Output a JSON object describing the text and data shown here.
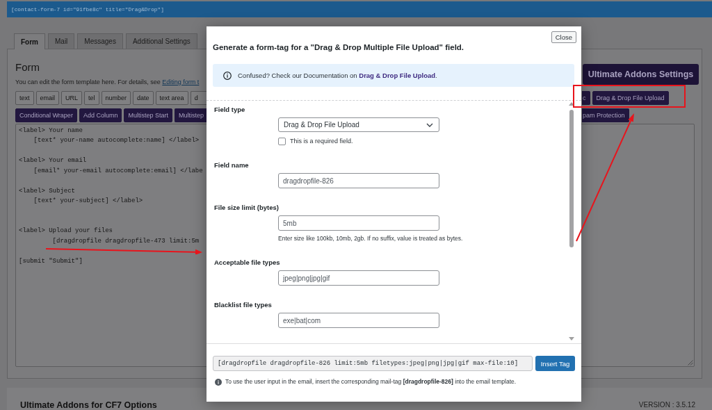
{
  "shortcode": "[contact-form-7 id=\"91fbe8c\" title=\"Drag&Drop\"]",
  "tabs": [
    {
      "label": "Form",
      "selected": true
    },
    {
      "label": "Mail",
      "selected": false
    },
    {
      "label": "Messages",
      "selected": false
    },
    {
      "label": "Additional Settings",
      "selected": false
    }
  ],
  "form_panel": {
    "heading": "Form",
    "description": "You can edit the form template here. For details, see ",
    "description_link": "Editing form t",
    "settings_button": "Ultimate Addons Settings",
    "tag_button_rows": [
      {
        "left": [
          {
            "label": "text",
            "kind": "default"
          },
          {
            "label": "email",
            "kind": "default"
          },
          {
            "label": "URL",
            "kind": "default"
          },
          {
            "label": "tel",
            "kind": "default"
          },
          {
            "label": "number",
            "kind": "default"
          },
          {
            "label": "date",
            "kind": "default"
          },
          {
            "label": "text area",
            "kind": "default"
          },
          {
            "label": "d",
            "kind": "default"
          }
        ],
        "right": [
          {
            "label": "c",
            "kind": "addon"
          },
          {
            "label": "Drag & Drop File Upload",
            "kind": "addon"
          }
        ]
      },
      {
        "left": [
          {
            "label": "Conditional Wraper",
            "kind": "addon"
          },
          {
            "label": "Add Column",
            "kind": "addon"
          },
          {
            "label": "Multistep Start",
            "kind": "addon"
          },
          {
            "label": "Multistep",
            "kind": "addon"
          }
        ],
        "right": [
          {
            "label": "pam Protection",
            "kind": "addon"
          }
        ]
      }
    ],
    "template": "<label> Your name\n    [text* your-name autocomplete:name] </label>\n\n<label> Your email\n    [email* your-email autocomplete:email] </labe\n\n<label> Subject\n    [text* your-subject] </label>\n\n\n<label> Upload your files\n         [dragdropfile dragdropfile-473 limit:5m\n\n[submit \"Submit\"]"
  },
  "options_section": {
    "title": "Ultimate Addons for CF7 Options",
    "version": "VERSION : 3.5.12"
  },
  "modal": {
    "close": "Close",
    "title": "Generate a form-tag for a \"Drag & Drop Multiple File Upload\" field.",
    "notice": {
      "text": "Confused? Check our Documentation on ",
      "link": "Drag & Drop File Upload",
      "after": "."
    },
    "fields": [
      {
        "kind": "select",
        "label": "Field type",
        "value": "Drag & Drop File Upload",
        "checkbox": {
          "label": "This is a required field.",
          "checked": false
        }
      },
      {
        "kind": "text",
        "label": "Field name",
        "value": "dragdropfile-826"
      },
      {
        "kind": "text",
        "label": "File size limit (bytes)",
        "value": "5mb",
        "hint": "Enter size like 100kb, 10mb, 2gb. If no suffix, value is treated as bytes."
      },
      {
        "kind": "text",
        "label": "Acceptable file types",
        "value": "jpeg|png|jpg|gif"
      },
      {
        "kind": "text",
        "label": "Blacklist file types",
        "value": "exe|bat|com"
      }
    ],
    "tag_output": "[dragdropfile dragdropfile-826 limit:5mb filetypes:jpeg|png|jpg|gif max-file:10]",
    "insert_button": "Insert Tag",
    "mail_tag_note": "To use the user input in the email, insert the corresponding mail-tag **[dragdropfile-826]** into the email template."
  }
}
